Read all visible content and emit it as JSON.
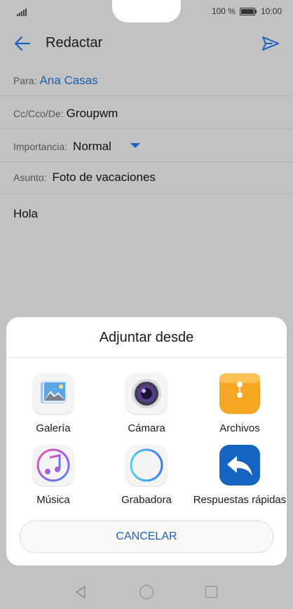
{
  "status": {
    "battery_text": "100 %",
    "time": "10:00",
    "battery_level": 1.0
  },
  "toolbar": {
    "title": "Redactar",
    "back_icon": "arrow-left-icon",
    "send_icon": "send-icon"
  },
  "compose": {
    "to_label": "Para:",
    "to_value": "Ana Casas",
    "cc_label": "Cc/Cco/De:",
    "cc_value": "Groupwm",
    "importance_label": "Importancia:",
    "importance_value": "Normal",
    "subject_label": "Asunto:",
    "subject_value": "Foto de vacaciones",
    "body": "Hola"
  },
  "sheet": {
    "title": "Adjuntar desde",
    "options": [
      {
        "label": "Galería",
        "icon": "gallery-icon"
      },
      {
        "label": "Cámara",
        "icon": "camera-icon"
      },
      {
        "label": "Archivos",
        "icon": "files-icon"
      },
      {
        "label": "Música",
        "icon": "music-icon"
      },
      {
        "label": "Grabadora",
        "icon": "recorder-icon"
      },
      {
        "label": "Respuestas rápidas",
        "icon": "quick-reply-icon"
      }
    ],
    "cancel_label": "CANCELAR"
  },
  "colors": {
    "accent": "#1b5fb3",
    "scrim": "#c2c2c2",
    "sheet": "#ffffff",
    "files_orange": "#f5a623",
    "reply_blue": "#1565c0"
  }
}
